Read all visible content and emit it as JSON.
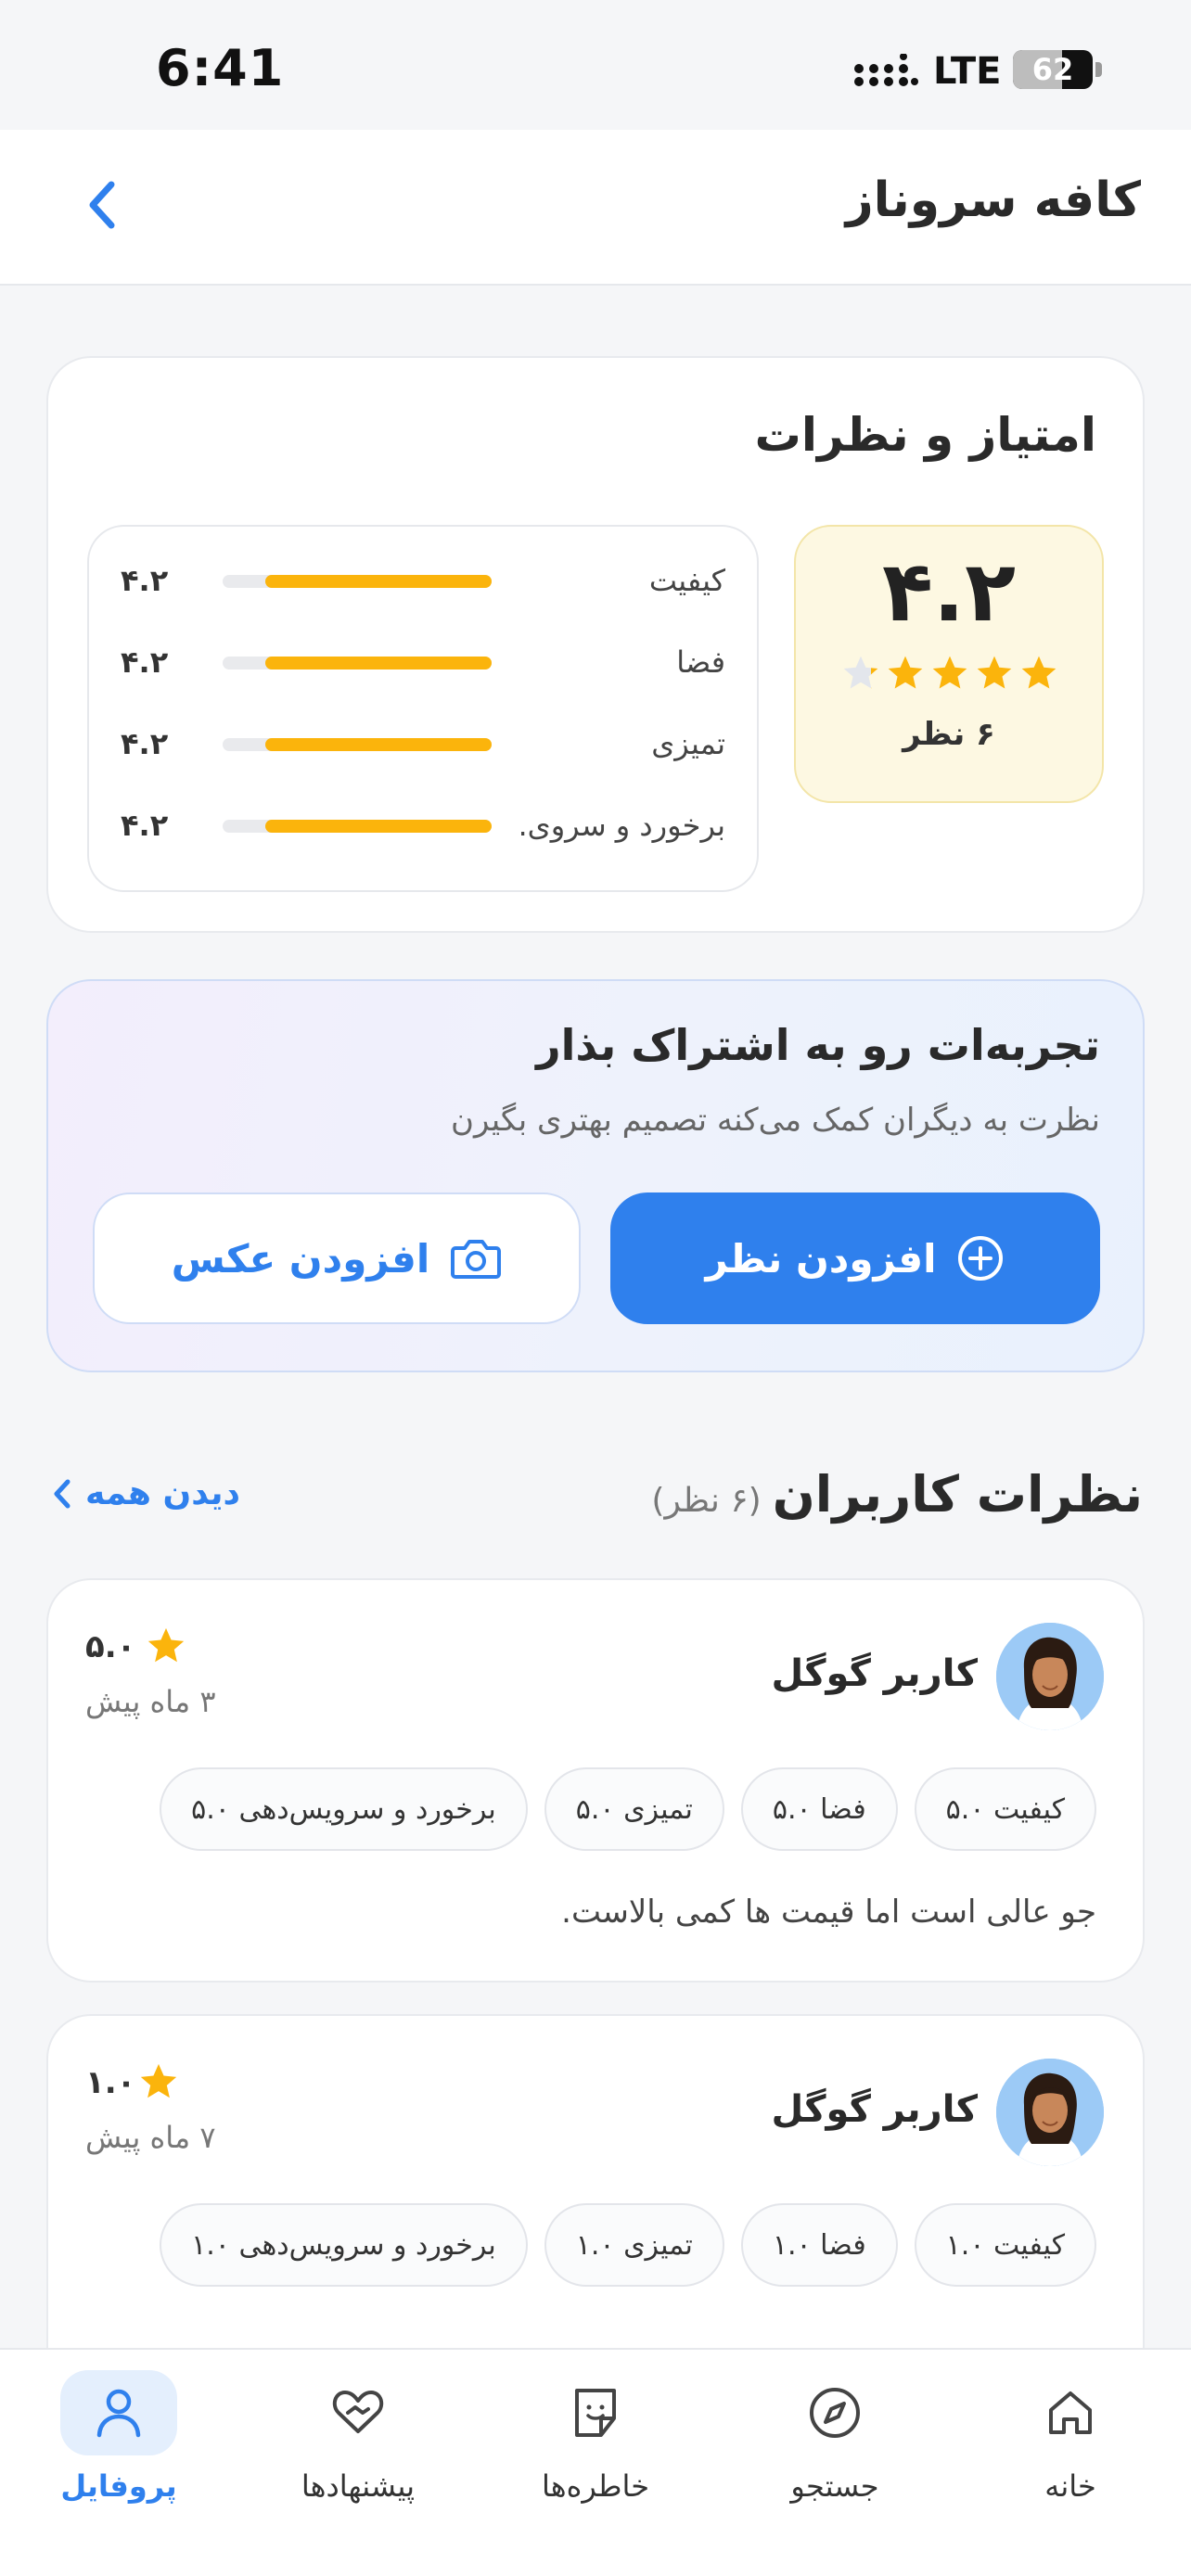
{
  "status_bar": {
    "time": "6:41",
    "network": "LTE",
    "battery": "62",
    "battery_level": 0.62
  },
  "header": {
    "title": "کافه سروناز"
  },
  "rating": {
    "title": "امتیاز و نظرات",
    "score": "۴.۲",
    "stars": 4.2,
    "count_label": "۶ نظر",
    "criteria": [
      {
        "label": "کیفیت",
        "value": "۴.۲",
        "fraction": 0.84
      },
      {
        "label": "فضا",
        "value": "۴.۲",
        "fraction": 0.84
      },
      {
        "label": "تمیزی",
        "value": "۴.۲",
        "fraction": 0.84
      },
      {
        "label": "برخورد و سروی...",
        "value": "۴.۲",
        "fraction": 0.84
      }
    ]
  },
  "share": {
    "title": "تجربه‌ات رو به اشتراک بذار",
    "subtitle": "نظرت به دیگران کمک می‌کنه تصمیم بهتری بگیرن",
    "add_review": "افزودن نظر",
    "add_photo": "افزودن عکس"
  },
  "reviews": {
    "title": "نظرات کاربران",
    "count": "(۶ نظر)",
    "see_all": "دیدن همه",
    "items": [
      {
        "name": "کاربر گوگل",
        "score": "۵.۰",
        "time": "۳ ماه پیش",
        "chips": [
          "کیفیت ۵.۰",
          "فضا ۵.۰",
          "تمیزی ۵.۰",
          "برخورد و سرویس‌دهی ۵.۰"
        ],
        "text": "جو عالی است اما قیمت ها کمی بالاست."
      },
      {
        "name": "کاربر گوگل",
        "score": "۱.۰",
        "time": "۷ ماه پیش",
        "chips": [
          "کیفیت ۱.۰",
          "فضا ۱.۰",
          "تمیزی ۱.۰",
          "برخورد و سرویس‌دهی ۱.۰"
        ],
        "text": ""
      }
    ]
  },
  "nav": {
    "items": [
      {
        "label": "خانه",
        "icon": "home-icon"
      },
      {
        "label": "جستجو",
        "icon": "compass-icon"
      },
      {
        "label": "خاطره‌ها",
        "icon": "memories-icon"
      },
      {
        "label": "پیشنهادها",
        "icon": "heart-hand-icon"
      },
      {
        "label": "پروفایل",
        "icon": "user-icon",
        "active": true
      }
    ]
  },
  "colors": {
    "accent": "#2f80ed",
    "star": "#fbb40c"
  }
}
